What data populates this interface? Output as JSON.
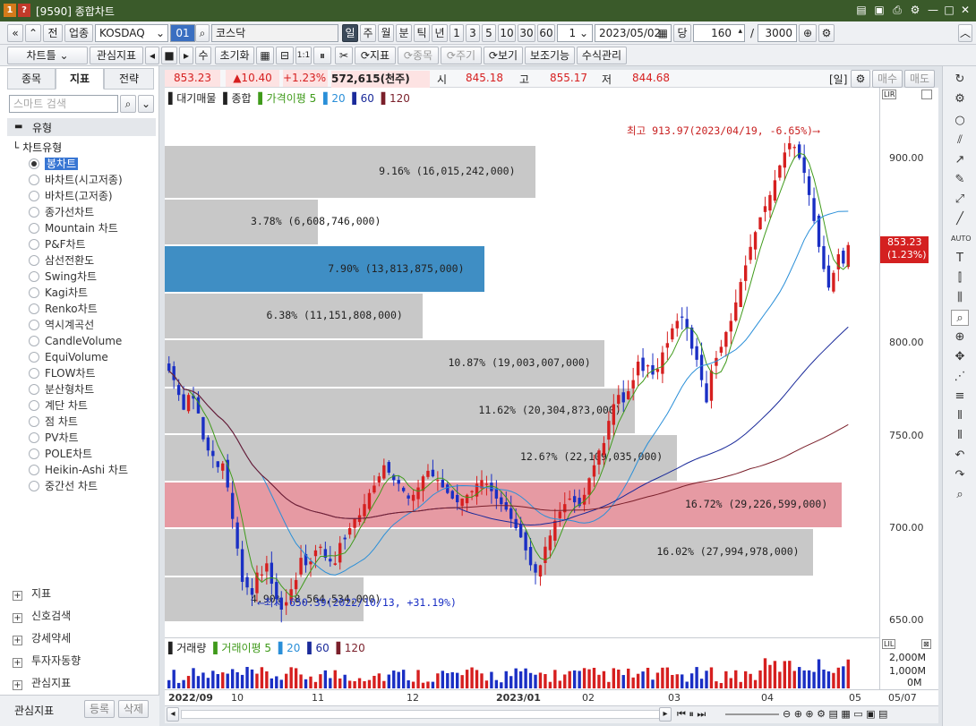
{
  "window": {
    "badge1": "1",
    "badge2": "?",
    "title": "[9590] 종합차트",
    "controls": [
      "▤",
      "▣",
      "⎙",
      "⚙",
      "—",
      "□",
      "✕"
    ]
  },
  "toolbar1": {
    "nav_prev": "«",
    "nav_up": "⌃",
    "prev_label": "전",
    "sector_label": "업종",
    "market_value": "KOSDAQ",
    "code_value": "01",
    "name_value": "코스닥",
    "periods": [
      "일",
      "주",
      "월",
      "분",
      "틱",
      "년"
    ],
    "selected_period": "일",
    "intervals": [
      "1",
      "3",
      "5",
      "10",
      "30",
      "60"
    ],
    "count_value": "1",
    "date_value": "2023/05/02",
    "dang_label": "당",
    "bars_value": "160",
    "slash": "/",
    "total_value": "3000",
    "collapse": "︿"
  },
  "toolbar2": {
    "chart_label": "차트틀",
    "watch_label": "관심지표",
    "su_label": "수",
    "reset_label": "초기화",
    "indicator_label": "지표",
    "item_label": "종목",
    "cycle_label": "주기",
    "view_label": "보기",
    "aux_label": "보조기능",
    "formula_label": "수식관리"
  },
  "left": {
    "tabs": [
      "종목",
      "지표",
      "전략"
    ],
    "selected_tab": "지표",
    "search_placeholder": "스마트 검색",
    "section_title": "유형",
    "tree_title": "차트유형",
    "chart_types": [
      "봉차트",
      "바차트(시고저종)",
      "바차트(고저종)",
      "종가선차트",
      "Mountain 차트",
      "P&F차트",
      "삼선전환도",
      "Swing차트",
      "Kagi차트",
      "Renko차트",
      "역시계곡선",
      "CandleVolume",
      "EquiVolume",
      "FLOW차트",
      "분산형차트",
      "계단 차트",
      "점 차트",
      "PV차트",
      "POLE차트",
      "Heikin-Ashi 차트",
      "중간선 차트"
    ],
    "selected_chart_type": "봉차트",
    "bottom_sections": [
      "지표",
      "신호검색",
      "강세약세",
      "투자자동향",
      "관심지표"
    ],
    "footer_label": "관심지표",
    "register_btn": "등록",
    "delete_btn": "삭제"
  },
  "infobar": {
    "price": "853.23",
    "change": "▲10.40",
    "change_pct": "+1.23%",
    "volume": "572,615(천주)",
    "open_label": "시",
    "open": "845.18",
    "high_label": "고",
    "high": "855.17",
    "low_label": "저",
    "low": "844.68",
    "period_tag": "[일]",
    "buy_label": "매수",
    "sell_label": "매도"
  },
  "legend": {
    "items": [
      "대기매물",
      "종합",
      "가격이평 5",
      "20",
      "60",
      "120"
    ],
    "volume_items": [
      "거래량",
      "거래이평 5",
      "20",
      "60",
      "120"
    ]
  },
  "colors": {
    "up": "#d61f1f",
    "down": "#1a2fc4",
    "ma5": "#3f9a1a",
    "ma20": "#2a8fd8",
    "ma60": "#1a2a9a",
    "ma120": "#7a1f2a",
    "highlight_blue": "#3f8ec4",
    "highlight_red": "#e69aa3"
  },
  "annotations": {
    "high": "최고 913.97(2023/04/19, -6.65%)⟶",
    "low": "⟵최저 650.39(2022/10/13, +31.19%)",
    "current_price": "853.23",
    "current_pct": "(1.23%)"
  },
  "volume_profile": [
    {
      "label": "9.16% (16,015,242,000)",
      "band": [
        878,
        907
      ],
      "pct": 9.16
    },
    {
      "label": "3.78% (6,608,746,000)",
      "band": [
        853,
        878
      ],
      "pct": 3.78
    },
    {
      "label": "7.90% (13,813,875,000)",
      "band": [
        827,
        853
      ],
      "pct": 7.9,
      "highlight": "blue"
    },
    {
      "label": "6.38% (11,151,808,000)",
      "band": [
        802,
        827
      ],
      "pct": 6.38
    },
    {
      "label": "10.87% (19,003,007,000)",
      "band": [
        776,
        802
      ],
      "pct": 10.87
    },
    {
      "label": "11.62% (20,304,8?3,000)",
      "band": [
        751,
        776
      ],
      "pct": 11.62
    },
    {
      "label": "12.6?% (22,109,035,000)",
      "band": [
        725,
        751
      ],
      "pct": 12.65
    },
    {
      "label": "16.72% (29,226,599,000)",
      "band": [
        700,
        725
      ],
      "pct": 16.72,
      "highlight": "red"
    },
    {
      "label": "16.02% (27,994,978,000)",
      "band": [
        674,
        700
      ],
      "pct": 16.02
    },
    {
      "label": "4.90% (8,564,534,000)",
      "band": [
        649,
        674
      ],
      "pct": 4.9
    }
  ],
  "price_axis": [
    "900.00",
    "850.00",
    "800.00",
    "750.00",
    "700.00",
    "650.00"
  ],
  "volume_axis": [
    "2,000M",
    "1,000M",
    "0M"
  ],
  "x_axis": [
    "2022/09",
    "10",
    "11",
    "12",
    "2023/01",
    "02",
    "03",
    "04",
    "05"
  ],
  "x_axis_right": "05/07",
  "chart_data": {
    "type": "candlestick",
    "ylim": [
      641,
      938
    ],
    "closes": [
      785,
      780,
      772,
      764,
      772,
      770,
      762,
      748,
      742,
      739,
      733,
      735,
      722,
      705,
      689,
      671,
      668,
      664,
      676,
      675,
      681,
      670,
      662,
      656,
      660,
      667,
      672,
      684,
      680,
      682,
      688,
      690,
      684,
      682,
      681,
      692,
      694,
      700,
      705,
      707,
      713,
      719,
      723,
      728,
      734,
      730,
      726,
      724,
      720,
      716,
      718,
      722,
      728,
      731,
      728,
      726,
      722,
      719,
      716,
      714,
      716,
      718,
      720,
      724,
      726,
      724,
      720,
      716,
      713,
      710,
      705,
      700,
      695,
      688,
      680,
      676,
      680,
      690,
      696,
      704,
      709,
      713,
      716,
      714,
      712,
      718,
      727,
      734,
      742,
      746,
      758,
      767,
      772,
      768,
      774,
      780,
      790,
      785,
      788,
      783,
      786,
      795,
      800,
      808,
      812,
      814,
      808,
      797,
      791,
      780,
      768,
      785,
      792,
      798,
      806,
      812,
      822,
      833,
      842,
      852,
      860,
      868,
      874,
      880,
      888,
      896,
      903,
      908,
      906,
      900,
      892,
      880,
      866,
      852,
      840,
      830,
      838,
      848,
      843,
      853
    ]
  }
}
